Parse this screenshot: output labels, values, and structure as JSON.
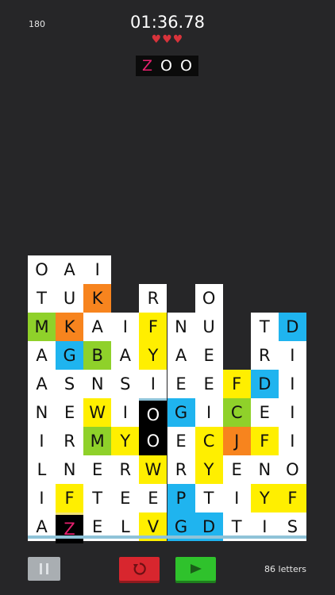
{
  "hud": {
    "score": "180",
    "timer": "01:36.78",
    "hearts": "♥♥♥",
    "letters_label": "86 letters"
  },
  "current_word": [
    {
      "letter": "Z",
      "color": "#e6206e"
    },
    {
      "letter": "O",
      "color": "#ffffff"
    },
    {
      "letter": "O",
      "color": "#ffffff"
    }
  ],
  "colors": {
    "W": "#ffffff",
    "Y": "#ffef00",
    "B": "#1fb4ef",
    "G": "#8fd12a",
    "O": "#f7841e",
    "K": "#000000"
  },
  "grid": [
    [
      "O.W",
      "A.W",
      "I.W",
      "",
      "",
      "",
      "",
      "",
      "",
      ""
    ],
    [
      "T.W",
      "U.W",
      "K.O",
      "",
      "R.W",
      "",
      "O.W",
      "",
      "",
      ""
    ],
    [
      "M.G",
      "K.O",
      "A.W",
      "I.W",
      "F.Y",
      "N.W",
      "U.W",
      "",
      "T.W",
      "D.B"
    ],
    [
      "A.W",
      "G.B",
      "B.G",
      "A.W",
      "Y.Y",
      "A.W",
      "E.W",
      "",
      "R.W",
      "I.W"
    ],
    [
      "A.W",
      "S.W",
      "N.W",
      "S.W",
      "I.W",
      "E.W",
      "E.W",
      "F.Y",
      "D.B",
      "I.W"
    ],
    [
      "N.W",
      "E.W",
      "W.Y",
      "I.W",
      "O.K",
      "G.B",
      "I.W",
      "C.G",
      "E.W",
      "I.W"
    ],
    [
      "I.W",
      "R.W",
      "M.G",
      "Y.Y",
      "O.K",
      "E.W",
      "C.Y",
      "J.O",
      "F.Y",
      "I.W"
    ],
    [
      "L.W",
      "N.W",
      "E.W",
      "R.W",
      "W.Y",
      "R.W",
      "Y.Y",
      "E.W",
      "N.W",
      "O.W"
    ],
    [
      "I.W",
      "F.Y",
      "T.W",
      "E.W",
      "E.W",
      "P.B",
      "T.W",
      "I.W",
      "Y.Y",
      "F.Y"
    ],
    [
      "A.W",
      "Z.K",
      "E.W",
      "L.W",
      "V.Y",
      "G.B",
      "D.B",
      "T.W",
      "I.W",
      "S.W"
    ]
  ]
}
